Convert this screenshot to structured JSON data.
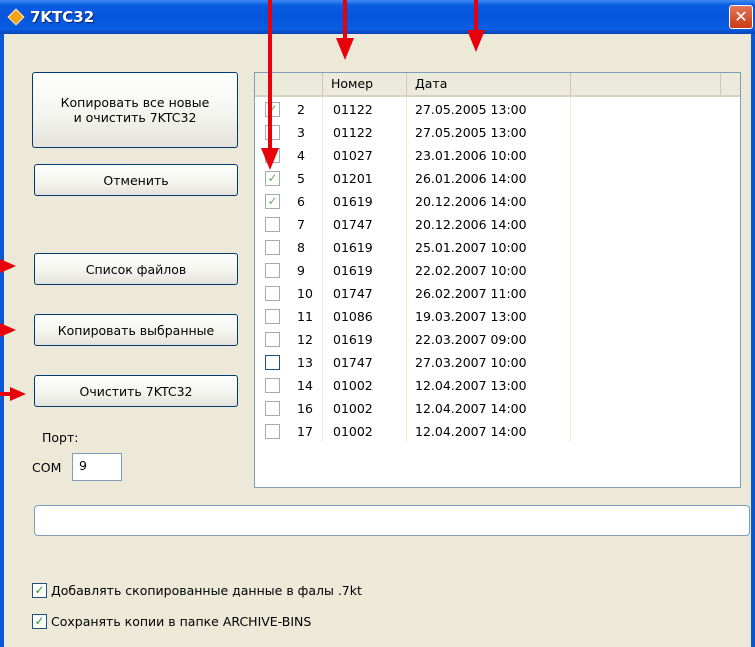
{
  "window": {
    "title": "7KTC32",
    "close_glyph": "✕"
  },
  "buttons": {
    "copy_all_line1": "Копировать все новые",
    "copy_all_line2": "и очистить 7KTC32",
    "cancel": "Отменить",
    "file_list": "Список файлов",
    "copy_selected": "Копировать выбранные",
    "clear": "Очистить 7KTC32"
  },
  "port": {
    "label": "Порт:",
    "prefix": "COM",
    "value": "9"
  },
  "list": {
    "headers": [
      "Номер",
      "Дата"
    ],
    "rows": [
      {
        "num": "2",
        "id": "01122",
        "date": "27.05.2005 13:00",
        "checked": true
      },
      {
        "num": "3",
        "id": "01122",
        "date": "27.05.2005 13:00",
        "checked": false
      },
      {
        "num": "4",
        "id": "01027",
        "date": "23.01.2006 10:00",
        "checked": false
      },
      {
        "num": "5",
        "id": "01201",
        "date": "26.01.2006 14:00",
        "checked": true
      },
      {
        "num": "6",
        "id": "01619",
        "date": "20.12.2006 14:00",
        "checked": true
      },
      {
        "num": "7",
        "id": "01747",
        "date": "20.12.2006 14:00",
        "checked": false
      },
      {
        "num": "8",
        "id": "01619",
        "date": "25.01.2007 10:00",
        "checked": false
      },
      {
        "num": "9",
        "id": "01619",
        "date": "22.02.2007 10:00",
        "checked": false
      },
      {
        "num": "10",
        "id": "01747",
        "date": "26.02.2007 11:00",
        "checked": false
      },
      {
        "num": "11",
        "id": "01086",
        "date": "19.03.2007 13:00",
        "checked": false
      },
      {
        "num": "12",
        "id": "01619",
        "date": "22.03.2007 09:00",
        "checked": false
      },
      {
        "num": "13",
        "id": "01747",
        "date": "27.03.2007 10:00",
        "checked": false
      },
      {
        "num": "14",
        "id": "01002",
        "date": "12.04.2007 13:00",
        "checked": false
      },
      {
        "num": "16",
        "id": "01002",
        "date": "12.04.2007 14:00",
        "checked": false
      },
      {
        "num": "17",
        "id": "01002",
        "date": "12.04.2007 14:00",
        "checked": false
      }
    ]
  },
  "options": {
    "append_7kt": {
      "label": "Добавлять скопированные данные в фалы .7kt",
      "checked": true
    },
    "archive_copies": {
      "label": "Сохранять копии в папке ARCHIVE-BINS",
      "checked": true
    }
  },
  "colors": {
    "annotation_arrow": "#e8000b",
    "title_bar": "#0554dc",
    "window_bg": "#ece9d8"
  },
  "icons": {
    "app": "app-diamond-icon",
    "check": "check-mark-icon"
  }
}
